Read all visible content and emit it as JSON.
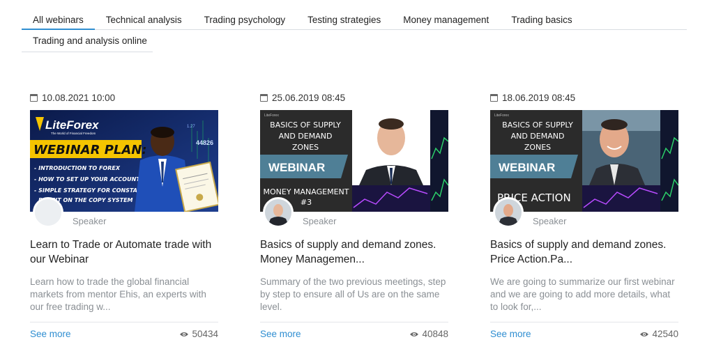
{
  "tabs": [
    {
      "label": "All webinars",
      "active": true
    },
    {
      "label": "Technical analysis"
    },
    {
      "label": "Trading psychology"
    },
    {
      "label": "Testing strategies"
    },
    {
      "label": "Money management"
    },
    {
      "label": "Trading basics"
    },
    {
      "label": "Trading and analysis online"
    }
  ],
  "cards": [
    {
      "date": "10.08.2021 10:00",
      "speaker_label": "Speaker",
      "title": "Learn to Trade or Automate trade with our Webinar",
      "description": "Learn how to trade the global financial markets from mentor Ehis, an experts with our free trading w...",
      "see_more": "See more",
      "views": "50434",
      "thumb": {
        "brand": "LiteForex",
        "brand_sub": "The World of Financial Freedom",
        "headline": "WEBINAR PLAN:",
        "bullets": [
          "- INTRODUCTION TO FOREX",
          "- HOW TO SET UP YOUR ACCOUNT AS EXPERT",
          "- SIMPLE STRATEGY FOR CONSTANT",
          "PROFIT ON THE COPY SYSTEM"
        ]
      }
    },
    {
      "date": "25.06.2019 08:45",
      "speaker_label": "Speaker",
      "title": "Basics of supply and demand zones. Money Managemen...",
      "description": "Summary of the two previous meetings, step by step to ensure all of Us are on the same level.",
      "see_more": "See more",
      "views": "40848",
      "thumb": {
        "brand": "LiteForex",
        "top_line1": "BASICS OF SUPPLY",
        "top_line2": "AND DEMAND",
        "top_line3": "ZONES",
        "banner": "WEBINAR",
        "bottom_line1": "MONEY MANAGEMENT",
        "bottom_line2": "#3"
      }
    },
    {
      "date": "18.06.2019 08:45",
      "speaker_label": "Speaker",
      "title": "Basics of supply and demand zones. Price Action.Pa...",
      "description": "We are going to summarize our first webinar and we are going to add more details, what to look for,...",
      "see_more": "See more",
      "views": "42540",
      "thumb": {
        "brand": "LiteForex",
        "top_line1": "BASICS OF SUPPLY",
        "top_line2": "AND DEMAND",
        "top_line3": "ZONES",
        "banner": "WEBINAR",
        "bottom_line1": "PRICE ACTION"
      }
    }
  ],
  "colors": {
    "accent": "#2f8ed1",
    "muted": "#8a8f94",
    "thumb_dark": "#2e2e2e",
    "thumb_yellow": "#f5c400",
    "thumb_blue": "#0a1b4a"
  },
  "icons": {
    "date": "calendar-icon",
    "views": "eye-icon"
  }
}
